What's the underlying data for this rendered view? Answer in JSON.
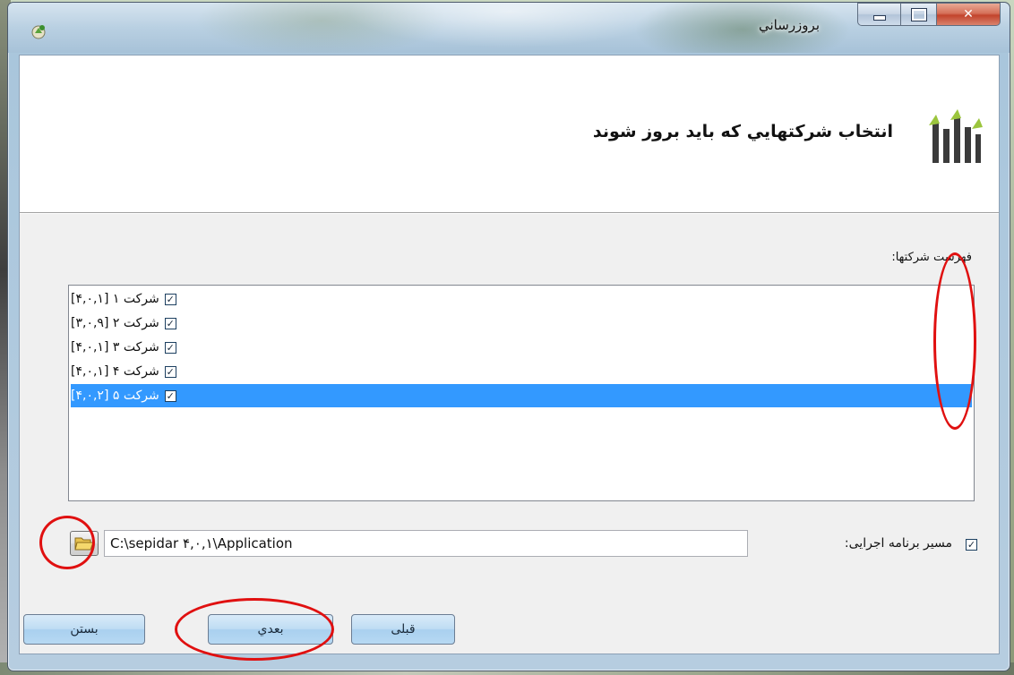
{
  "window": {
    "title": "بروزرساني"
  },
  "header": {
    "title": "انتخاب شركتهايي كه بايد بروز شوند"
  },
  "companies": {
    "label": "فهرست شركتها:",
    "items": [
      {
        "text": "شرکت ۱ [۴,۰,۱]",
        "checked": true,
        "selected": false
      },
      {
        "text": "شرکت ۲ [۳,۰,۹]",
        "checked": true,
        "selected": false
      },
      {
        "text": "شرکت ۳ [۴,۰,۱]",
        "checked": true,
        "selected": false
      },
      {
        "text": "شرکت ۴ [۴,۰,۱]",
        "checked": true,
        "selected": false
      },
      {
        "text": "شرکت ۵ [۴,۰,۲]",
        "checked": true,
        "selected": true
      }
    ]
  },
  "exe_path": {
    "label": "مسیر برنامه اجرایی:",
    "checked": true,
    "value": "C:\\sepidar ۴,۰,۱\\Application"
  },
  "buttons": {
    "prev": "قبلی",
    "next": "بعدي",
    "close": "بستن"
  },
  "colors": {
    "selection": "#3399ff",
    "annotation": "#e01010"
  },
  "icons": {
    "app": "app-update-icon",
    "logo": "sepidar-logo",
    "browse": "folder-open-icon"
  }
}
